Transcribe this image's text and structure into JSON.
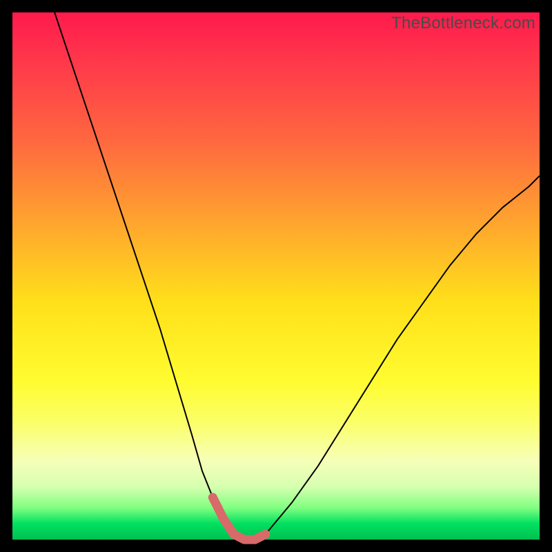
{
  "watermark": "TheBottleneck.com",
  "colors": {
    "background": "#000000",
    "curve": "#000000",
    "highlight": "#d86a6a"
  },
  "chart_data": {
    "type": "line",
    "title": "",
    "xlabel": "",
    "ylabel": "",
    "xlim": [
      0,
      100
    ],
    "ylim": [
      0,
      100
    ],
    "grid": false,
    "legend": false,
    "series": [
      {
        "name": "bottleneck-curve",
        "x": [
          8,
          12,
          16,
          20,
          24,
          28,
          31,
          34,
          36,
          38,
          40,
          42,
          44,
          46,
          48,
          53,
          58,
          63,
          68,
          73,
          78,
          83,
          88,
          93,
          98,
          100
        ],
        "y": [
          100,
          88,
          76,
          64,
          52,
          40,
          30,
          20,
          13,
          8,
          4,
          1,
          0,
          0,
          1,
          7,
          14,
          22,
          30,
          38,
          45,
          52,
          58,
          63,
          67,
          69
        ]
      },
      {
        "name": "highlight-band",
        "x": [
          38,
          40,
          42,
          44,
          46,
          48
        ],
        "y": [
          8,
          4,
          1,
          0,
          0,
          1
        ]
      }
    ]
  }
}
